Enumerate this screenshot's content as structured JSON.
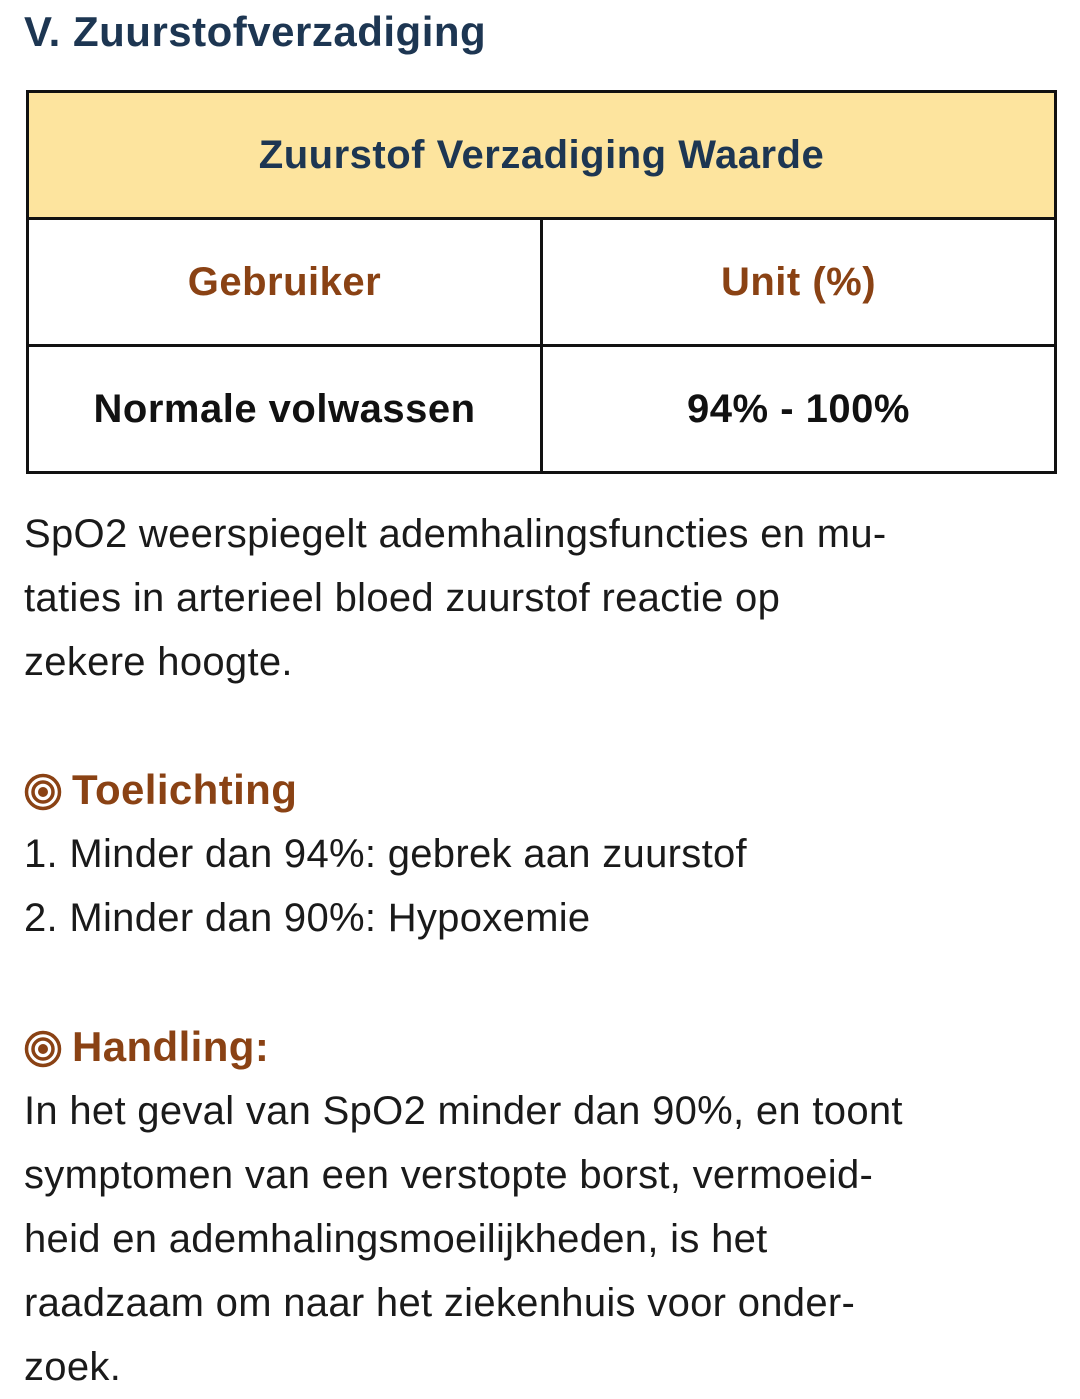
{
  "section": {
    "title": "V. Zuurstofverzadiging"
  },
  "table": {
    "caption": "Zuurstof Verzadiging Waarde",
    "headers": [
      "Gebruiker",
      "Unit (%)"
    ],
    "rows": [
      [
        "Normale volwassen",
        "94% - 100%"
      ]
    ]
  },
  "description": {
    "lines": [
      "SpO2 weerspiegelt ademhalingsfuncties en mu-",
      "taties in arterieel bloed zuurstof reactie op",
      "zekere hoogte."
    ]
  },
  "explanation": {
    "icon": "bullseye-icon",
    "heading": "Toelichting",
    "items": [
      "1. Minder dan 94%: gebrek aan zuurstof",
      "2. Minder dan 90%: Hypoxemie"
    ]
  },
  "handling": {
    "icon": "bullseye-icon",
    "heading": "Handling:",
    "lines": [
      "In het geval van SpO2 minder dan 90%, en toont",
      "symptomen van een verstopte borst, vermoeid-",
      "heid en ademhalingsmoeilijkheden, is het",
      "raadzaam om naar het ziekenhuis voor onder-",
      "zoek."
    ]
  },
  "colors": {
    "title_navy": "#1d3652",
    "accent_brown": "#8a4214",
    "table_caption_bg": "#fde49e"
  }
}
